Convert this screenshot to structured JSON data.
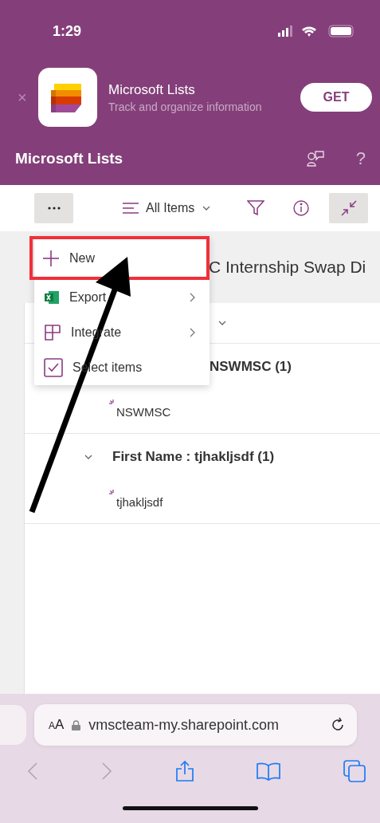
{
  "status_bar": {
    "time": "1:29"
  },
  "app_banner": {
    "close": "×",
    "title": "Microsoft Lists",
    "subtitle": "Track and organize information",
    "button": "GET"
  },
  "header": {
    "title": "Microsoft Lists",
    "help": "?"
  },
  "toolbar": {
    "view": "All Items"
  },
  "list_title": "C Internship Swap Di",
  "groups": [
    {
      "header": "NSWMSC (1)",
      "items": [
        "NSWMSC"
      ]
    },
    {
      "header": "First Name : tjhakljsdf (1)",
      "expanded": true,
      "items": [
        "tjhakljsdf"
      ]
    }
  ],
  "menu": {
    "items": [
      {
        "kind": "new",
        "label": "New",
        "highlighted": true,
        "submenu": false
      },
      {
        "kind": "export",
        "label": "Export",
        "highlighted": false,
        "submenu": true
      },
      {
        "kind": "integrate",
        "label": "Integrate",
        "highlighted": false,
        "submenu": true
      },
      {
        "kind": "select",
        "label": "Select items",
        "highlighted": false,
        "submenu": false
      }
    ]
  },
  "browser": {
    "text_size": "AA",
    "url": "vmscteam-my.sharepoint.com"
  }
}
